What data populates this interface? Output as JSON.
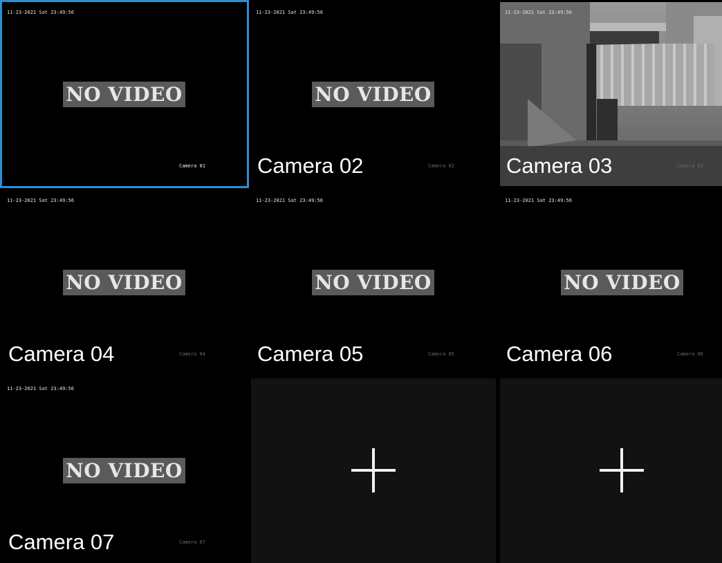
{
  "timestamp": "11-23-2021 Sat 23:49:56",
  "no_video_text": "NO VIDEO",
  "cameras": [
    {
      "label": "",
      "osd": "Camera 01",
      "status": "no-video",
      "selected": true
    },
    {
      "label": "Camera 02",
      "osd": "Camera 02",
      "status": "no-video"
    },
    {
      "label": "Camera 03",
      "osd": "Camera 03",
      "status": "live"
    },
    {
      "label": "Camera 04",
      "osd": "Camera 04",
      "status": "no-video"
    },
    {
      "label": "Camera 05",
      "osd": "Camera 05",
      "status": "no-video"
    },
    {
      "label": "Camera 06",
      "osd": "Camera 06",
      "status": "no-video"
    },
    {
      "label": "Camera 07",
      "osd": "Camera 07",
      "status": "no-video"
    }
  ],
  "empty_slots": [
    {
      "icon": "plus-icon"
    },
    {
      "icon": "plus-icon"
    }
  ],
  "colors": {
    "selection_border": "#2b8fd6",
    "empty_slot_bg": "#121212",
    "no_video_bg": "#5a5a5a"
  }
}
